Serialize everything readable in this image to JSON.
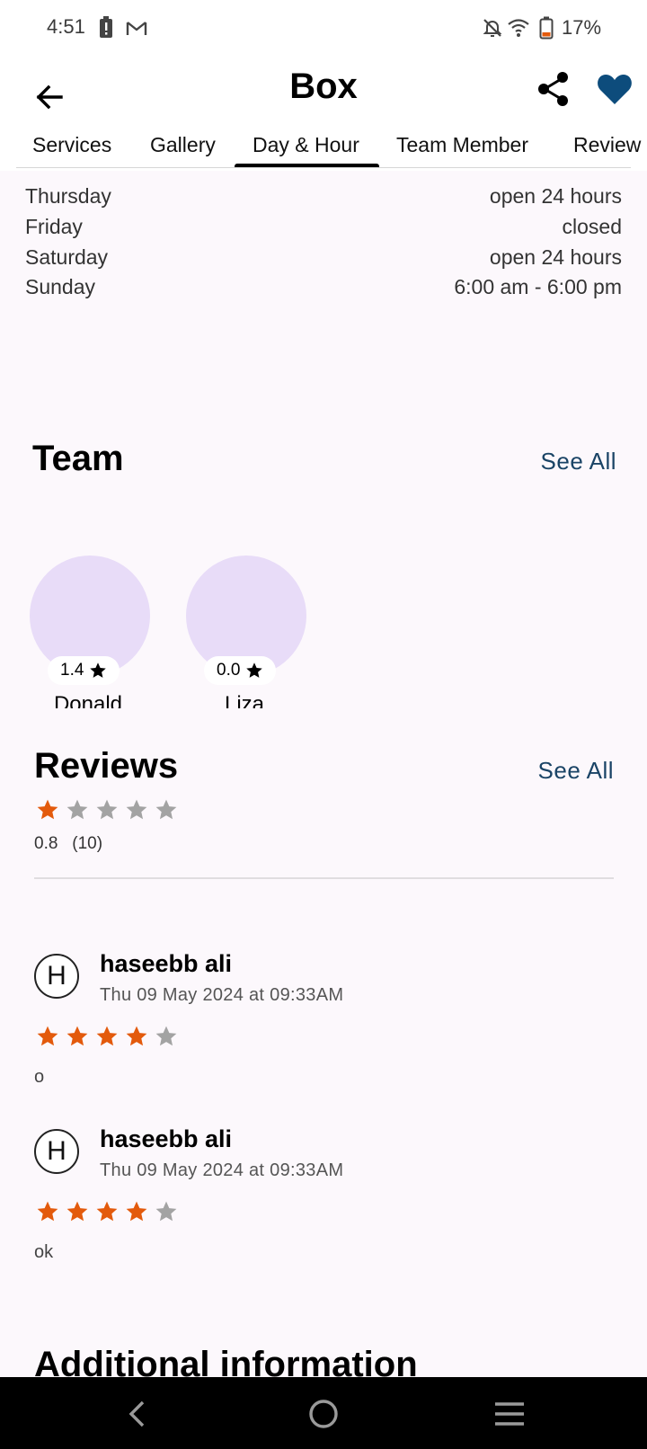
{
  "status_bar": {
    "time": "4:51",
    "battery": "17%"
  },
  "header": {
    "title": "Box"
  },
  "tabs": [
    {
      "label": "Services"
    },
    {
      "label": "Gallery"
    },
    {
      "label": "Day & Hour"
    },
    {
      "label": "Team Member"
    },
    {
      "label": "Review"
    }
  ],
  "hours": [
    {
      "day": "Thursday",
      "time": "open 24 hours"
    },
    {
      "day": "Friday",
      "time": "closed"
    },
    {
      "day": "Saturday",
      "time": "open 24 hours"
    },
    {
      "day": "Sunday",
      "time": "6:00 am - 6:00 pm"
    }
  ],
  "team": {
    "title": "Team",
    "see_all": "See All",
    "members": [
      {
        "name": "Donald",
        "rating": "1.4"
      },
      {
        "name": "Liza",
        "rating": "0.0"
      }
    ]
  },
  "reviews": {
    "title": "Reviews",
    "see_all": "See All",
    "average": "0.8",
    "count": "(10)",
    "average_stars": 1,
    "items": [
      {
        "initial": "H",
        "name": "haseebb ali",
        "date": "Thu 09 May 2024 at 09:33AM",
        "stars": 4,
        "text": "o"
      },
      {
        "initial": "H",
        "name": "haseebb ali",
        "date": "Thu 09 May 2024 at 09:33AM",
        "stars": 4,
        "text": "ok"
      }
    ]
  },
  "additional": {
    "title": "Additional information"
  },
  "colors": {
    "accent": "#1a4466",
    "star_filled": "#e35a0c",
    "star_empty": "#a3a3a3",
    "avatar_bg": "#e8dcf8"
  }
}
